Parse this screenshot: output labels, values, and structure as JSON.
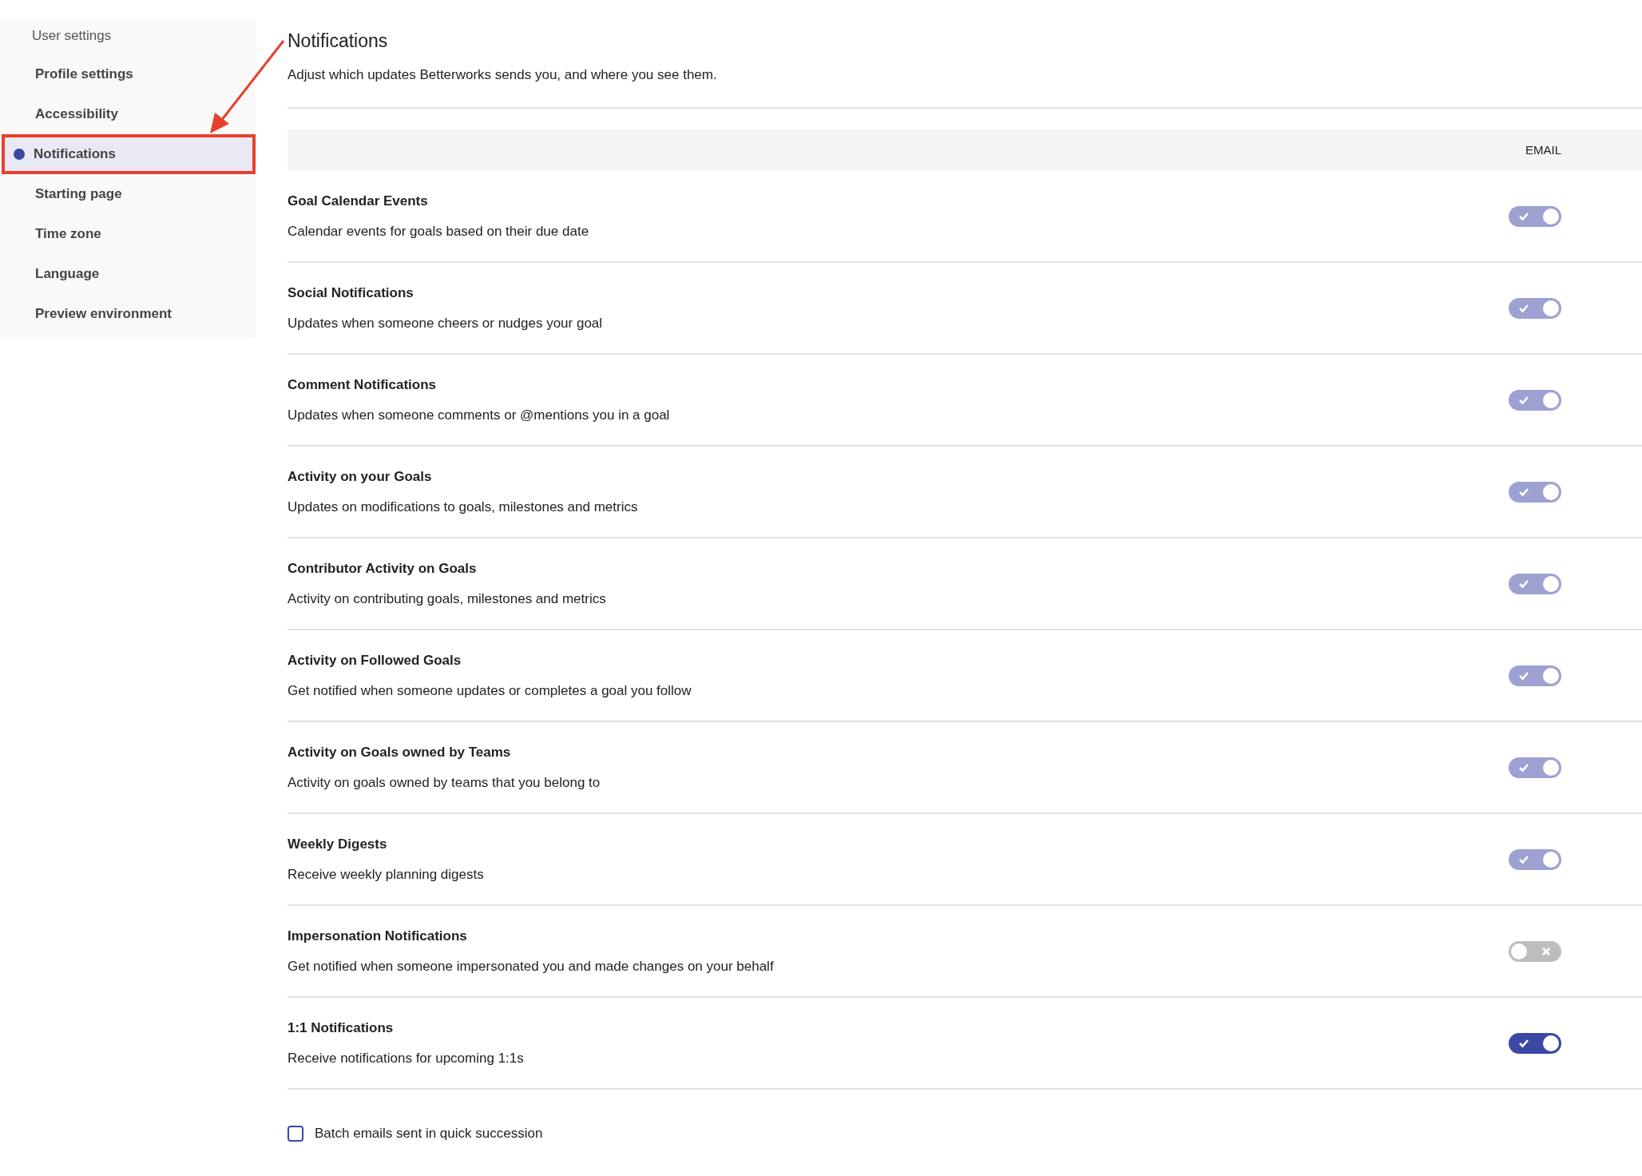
{
  "sidebar": {
    "heading": "User settings",
    "items": [
      {
        "label": "Profile settings",
        "selected": false
      },
      {
        "label": "Accessibility",
        "selected": false
      },
      {
        "label": "Notifications",
        "selected": true
      },
      {
        "label": "Starting page",
        "selected": false
      },
      {
        "label": "Time zone",
        "selected": false
      },
      {
        "label": "Language",
        "selected": false
      },
      {
        "label": "Preview environment",
        "selected": false
      }
    ]
  },
  "page": {
    "title": "Notifications",
    "subtitle": "Adjust which updates Betterworks sends you, and where you see them."
  },
  "table": {
    "column_header": "EMAIL",
    "rows": [
      {
        "title": "Goal Calendar Events",
        "description": "Calendar events for goals based on their due date",
        "on": true,
        "disabled": true
      },
      {
        "title": "Social Notifications",
        "description": "Updates when someone cheers or nudges your goal",
        "on": true,
        "disabled": true
      },
      {
        "title": "Comment Notifications",
        "description": "Updates when someone comments or @mentions you in a goal",
        "on": true,
        "disabled": true
      },
      {
        "title": "Activity on your Goals",
        "description": "Updates on modifications to goals, milestones and metrics",
        "on": true,
        "disabled": true
      },
      {
        "title": "Contributor Activity on Goals",
        "description": "Activity on contributing goals, milestones and metrics",
        "on": true,
        "disabled": true
      },
      {
        "title": "Activity on Followed Goals",
        "description": "Get notified when someone updates or completes a goal you follow",
        "on": true,
        "disabled": true
      },
      {
        "title": "Activity on Goals owned by Teams",
        "description": "Activity on goals owned by teams that you belong to",
        "on": true,
        "disabled": true
      },
      {
        "title": "Weekly Digests",
        "description": "Receive weekly planning digests",
        "on": true,
        "disabled": true
      },
      {
        "title": "Impersonation Notifications",
        "description": "Get notified when someone impersonated you and made changes on your behalf",
        "on": false,
        "disabled": true
      },
      {
        "title": "1:1 Notifications",
        "description": "Receive notifications for upcoming 1:1s",
        "on": true,
        "disabled": false
      }
    ]
  },
  "batch_option": {
    "label": "Batch emails sent in quick succession",
    "checked": false
  }
}
